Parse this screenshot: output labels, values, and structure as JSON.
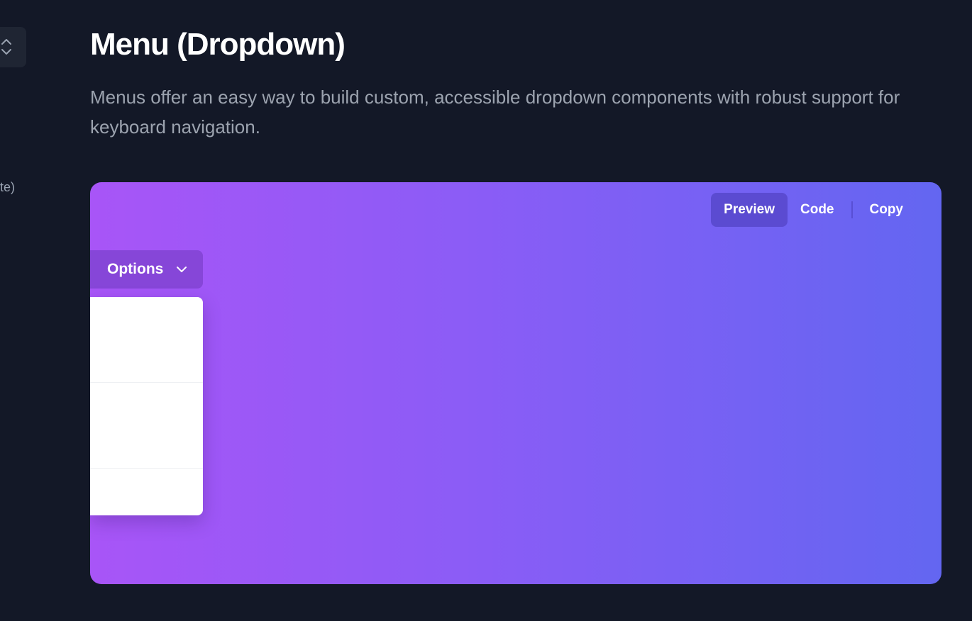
{
  "sidebar": {
    "select_icon": "chevron-up-down-icon",
    "fragment_text": "te)"
  },
  "page": {
    "title": "Menu (Dropdown)",
    "description": "Menus offer an easy way to build custom, accessible dropdown components with robust support for keyboard navigation."
  },
  "demo": {
    "gradient_from": "#a855f7",
    "gradient_to": "#6366f1",
    "tabs": [
      {
        "label": "Preview",
        "active": true
      },
      {
        "label": "Code",
        "active": false
      },
      {
        "label": "Copy",
        "active": false
      }
    ],
    "options_button": {
      "label": "Options",
      "icon": "chevron-down-icon"
    }
  }
}
